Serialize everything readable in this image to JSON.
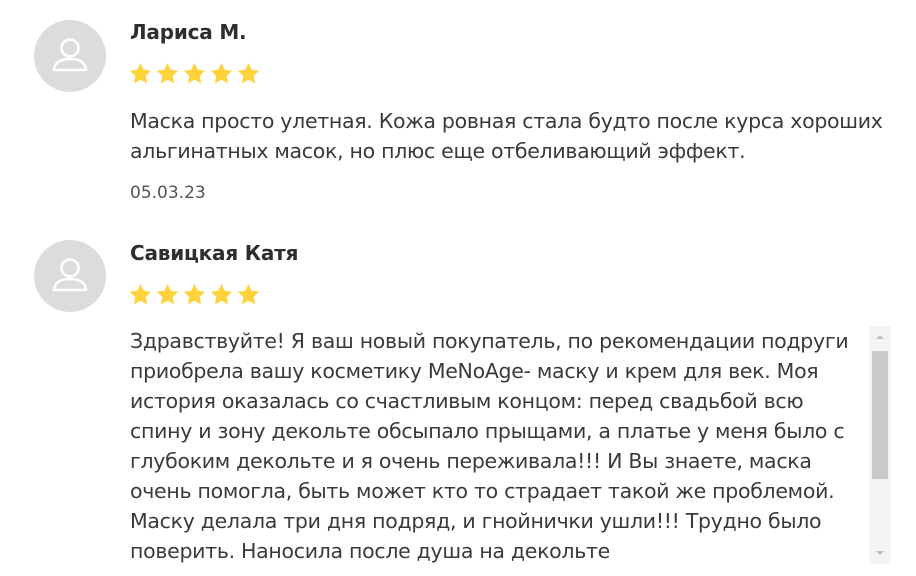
{
  "reviews": [
    {
      "author": "Лариса М.",
      "rating": 5,
      "rating_max": 5,
      "text": "Маска просто улетная. Кожа ровная стала будто после курса хороших альгинатных масок, но плюс еще отбеливающий эффект.",
      "date": "05.03.23",
      "avatar_icon": "user-icon"
    },
    {
      "author": "Савицкая Катя",
      "rating": 5,
      "rating_max": 5,
      "text": "Здравствуйте! Я ваш новый покупатель, по рекомендации подруги приобрела вашу косметику MeNoAge- маску и крем для век. Моя история оказалась со счастливым концом: перед свадьбой всю спину и зону декольте обсыпало прыщами, а платье у меня было с глубоким декольте и я очень переживала!!! И Вы знаете, маска очень помогла, быть может кто то страдает такой же проблемой. Маску делала три дня подряд, и гнойнички ушли!!! Трудно было поверить. Наносила после душа на декольте",
      "avatar_icon": "user-icon"
    }
  ],
  "colors": {
    "star": "#ffd33c",
    "avatar_bg": "#dcdcdc",
    "avatar_icon": "#ffffff",
    "scrollbar_track": "#f4f4f4",
    "scrollbar_thumb": "#c9c9c9"
  },
  "scrollbar": {
    "up_icon": "scroll-up-arrow-icon",
    "down_icon": "scroll-down-arrow-icon",
    "scroll_position": 0
  }
}
